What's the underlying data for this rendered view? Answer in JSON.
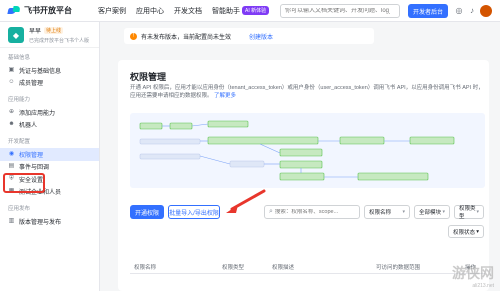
{
  "topbar": {
    "logo_text": "飞书开放平台",
    "nav": [
      {
        "label": "客户案例"
      },
      {
        "label": "应用中心"
      },
      {
        "label": "开发文档"
      },
      {
        "label": "智能助手",
        "badge": "AI 新体验"
      }
    ],
    "search_placeholder": "你可以输入文档关键词、开发问题、log_id、错误码",
    "dev_button": "开发者后台"
  },
  "app": {
    "name": "早早",
    "status": "待上线",
    "desc": "已完成开放平台飞书个人版"
  },
  "sidebar": {
    "sections": [
      {
        "title": "基础信息",
        "items": [
          {
            "label": "凭证与基础信息",
            "icon": "credential-icon"
          },
          {
            "label": "成员管理",
            "icon": "members-icon"
          }
        ]
      },
      {
        "title": "应用能力",
        "items": [
          {
            "label": "添加应用能力",
            "icon": "add-capability-icon"
          },
          {
            "label": "机器人",
            "icon": "robot-icon"
          }
        ]
      },
      {
        "title": "开发配置",
        "items": [
          {
            "label": "权限管理",
            "icon": "permission-icon",
            "active": true
          },
          {
            "label": "事件与回调",
            "icon": "event-icon"
          },
          {
            "label": "安全设置",
            "icon": "security-icon"
          },
          {
            "label": "测试企业和人员",
            "icon": "test-icon"
          }
        ]
      },
      {
        "title": "应用发布",
        "items": [
          {
            "label": "版本管理与发布",
            "icon": "version-icon"
          }
        ]
      }
    ]
  },
  "notice": {
    "text": "有未发布版本，当前配置尚未生效",
    "link": "创建版本"
  },
  "panel": {
    "title": "权限管理",
    "desc": "开通 API 权限后，应用才能以应用身份（tenant_access_token）或用户身份（user_access_token）调用飞书 API，以应用身份调用飞书 API 时，应用还需要申请相应的数据权限。",
    "desc_link": "了解更多"
  },
  "toolbar": {
    "enable_button": "开通权限",
    "batch_button": "批量导入/导出权限",
    "search_placeholder": "搜索：权限名称、scope...",
    "select1": "权限名称",
    "select2": "全部模块",
    "select3": "权限类型",
    "select4": "权限状态"
  },
  "table": {
    "headers": [
      "权限名称",
      "权限类型",
      "权限描述",
      "可访问的数据范围",
      "操作"
    ]
  },
  "watermark": {
    "text": "游侠网",
    "url": "ali213.net"
  },
  "colors": {
    "primary": "#3370ff",
    "highlight_red": "#e8362c",
    "diagram_bg": "#f2f6ff",
    "green": "#5bc24f"
  }
}
